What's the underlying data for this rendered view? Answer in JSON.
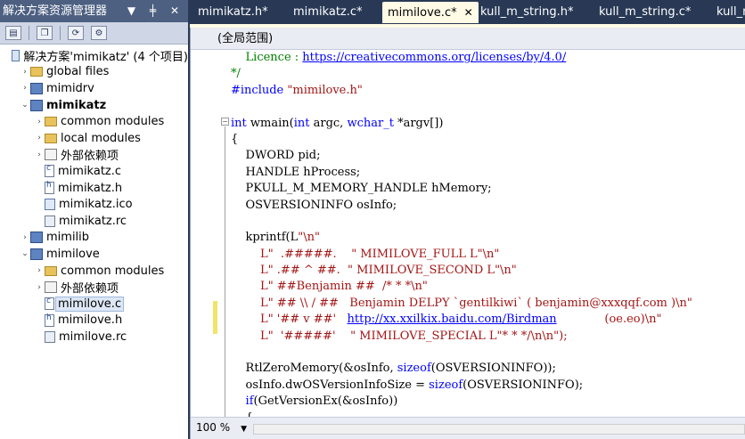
{
  "solution_explorer": {
    "title": "解决方案资源管理器",
    "title_buttons": "▼ ╪ ✕",
    "tree": [
      {
        "label": "解决方案'mimikatz' (4 个项目)",
        "indent": 0,
        "arrow": "",
        "icon": "sol",
        "bold": false
      },
      {
        "label": "global files",
        "indent": 1,
        "arrow": "›",
        "icon": "folder",
        "bold": false
      },
      {
        "label": "mimidrv",
        "indent": 1,
        "arrow": "›",
        "icon": "proj",
        "bold": false
      },
      {
        "label": "mimikatz",
        "indent": 1,
        "arrow": "⌄",
        "icon": "proj",
        "bold": true
      },
      {
        "label": "common modules",
        "indent": 2,
        "arrow": "›",
        "icon": "folder",
        "bold": false
      },
      {
        "label": "local modules",
        "indent": 2,
        "arrow": "›",
        "icon": "folder",
        "bold": false
      },
      {
        "label": "外部依赖项",
        "indent": 2,
        "arrow": "›",
        "icon": "ref",
        "bold": false
      },
      {
        "label": "mimikatz.c",
        "indent": 2,
        "arrow": "",
        "icon": "c",
        "bold": false
      },
      {
        "label": "mimikatz.h",
        "indent": 2,
        "arrow": "",
        "icon": "h",
        "bold": false
      },
      {
        "label": "mimikatz.ico",
        "indent": 2,
        "arrow": "",
        "icon": "ico",
        "bold": false
      },
      {
        "label": "mimikatz.rc",
        "indent": 2,
        "arrow": "",
        "icon": "rc",
        "bold": false
      },
      {
        "label": "mimilib",
        "indent": 1,
        "arrow": "›",
        "icon": "proj",
        "bold": false
      },
      {
        "label": "mimilove",
        "indent": 1,
        "arrow": "⌄",
        "icon": "proj",
        "bold": false
      },
      {
        "label": "common modules",
        "indent": 2,
        "arrow": "›",
        "icon": "folder",
        "bold": false
      },
      {
        "label": "外部依赖项",
        "indent": 2,
        "arrow": "›",
        "icon": "ref",
        "bold": false
      },
      {
        "label": "mimilove.c",
        "indent": 2,
        "arrow": "",
        "icon": "c",
        "bold": false,
        "selected": true
      },
      {
        "label": "mimilove.h",
        "indent": 2,
        "arrow": "",
        "icon": "h",
        "bold": false
      },
      {
        "label": "mimilove.rc",
        "indent": 2,
        "arrow": "",
        "icon": "rc",
        "bold": false
      }
    ]
  },
  "tabs": [
    {
      "label": "mimikatz.h*",
      "active": false
    },
    {
      "label": "mimikatz.c*",
      "active": false
    },
    {
      "label": "mimilove.c*",
      "active": true
    },
    {
      "label": "kull_m_string.h*",
      "active": false
    },
    {
      "label": "kull_m_string.c*",
      "active": false
    },
    {
      "label": "kull_m",
      "active": false
    }
  ],
  "active_tab_close": "✕",
  "editor": {
    "scope": "(全局范围)",
    "zoom": "100 %",
    "lines": [
      [
        {
          "t": "    Licence : ",
          "c": "cm"
        },
        {
          "t": "https://creativecommons.org/licenses/by/4.0/",
          "c": "link"
        }
      ],
      [
        {
          "t": "*/",
          "c": "cm"
        }
      ],
      [
        {
          "t": "#include ",
          "c": "pp"
        },
        {
          "t": "\"mimilove.h\"",
          "c": "str"
        }
      ],
      [
        {
          "t": "",
          "c": ""
        }
      ],
      [
        {
          "t": "int",
          "c": "kw"
        },
        {
          "t": " wmain(",
          "c": ""
        },
        {
          "t": "int",
          "c": "kw"
        },
        {
          "t": " argc, ",
          "c": ""
        },
        {
          "t": "wchar_t",
          "c": "kw"
        },
        {
          "t": " *argv[])",
          "c": ""
        }
      ],
      [
        {
          "t": "{",
          "c": ""
        }
      ],
      [
        {
          "t": "    DWORD pid;",
          "c": ""
        }
      ],
      [
        {
          "t": "    HANDLE hProcess;",
          "c": ""
        }
      ],
      [
        {
          "t": "    PKULL_M_MEMORY_HANDLE hMemory;",
          "c": ""
        }
      ],
      [
        {
          "t": "    OSVERSIONINFO osInfo;",
          "c": ""
        }
      ],
      [
        {
          "t": "",
          "c": ""
        }
      ],
      [
        {
          "t": "    kprintf(L",
          "c": ""
        },
        {
          "t": "\"\\n\"",
          "c": "str"
        }
      ],
      [
        {
          "t": "        L\"  .#####.    \" MIMILOVE_FULL L\"\\n\"",
          "c": "str"
        }
      ],
      [
        {
          "t": "        L\" .## ^ ##.  \" MIMILOVE_SECOND L\"\\n\"",
          "c": "str"
        }
      ],
      [
        {
          "t": "        L\" ##Benjamin ##  /* * *\\n\"",
          "c": "str"
        }
      ],
      [
        {
          "t": "        L\" ## \\\\ / ##   Benjamin DELPY `gentilkiwi` ( benjamin@xxxqqf.com )\\n\"",
          "c": "str"
        }
      ],
      [
        {
          "t": "        L\" '## v ##'   ",
          "c": "str"
        },
        {
          "t": "http://xx.xxilkix.baidu.com/Birdman",
          "c": "link"
        },
        {
          "t": "             (oe.eo)\\n\"",
          "c": "str"
        }
      ],
      [
        {
          "t": "        L\"  '#####'    \" MIMILOVE_SPECIAL L\"* * */\\n\\n\");",
          "c": "str"
        }
      ],
      [
        {
          "t": "",
          "c": ""
        }
      ],
      [
        {
          "t": "    RtlZeroMemory(&osInfo, ",
          "c": ""
        },
        {
          "t": "sizeof",
          "c": "kw"
        },
        {
          "t": "(OSVERSIONINFO));",
          "c": ""
        }
      ],
      [
        {
          "t": "    osInfo.dwOSVersionInfoSize = ",
          "c": ""
        },
        {
          "t": "sizeof",
          "c": "kw"
        },
        {
          "t": "(OSVERSIONINFO);",
          "c": ""
        }
      ],
      [
        {
          "t": "    ",
          "c": ""
        },
        {
          "t": "if",
          "c": "kw"
        },
        {
          "t": "(GetVersionEx(&osInfo))",
          "c": ""
        }
      ],
      [
        {
          "t": "    {",
          "c": ""
        }
      ]
    ]
  }
}
